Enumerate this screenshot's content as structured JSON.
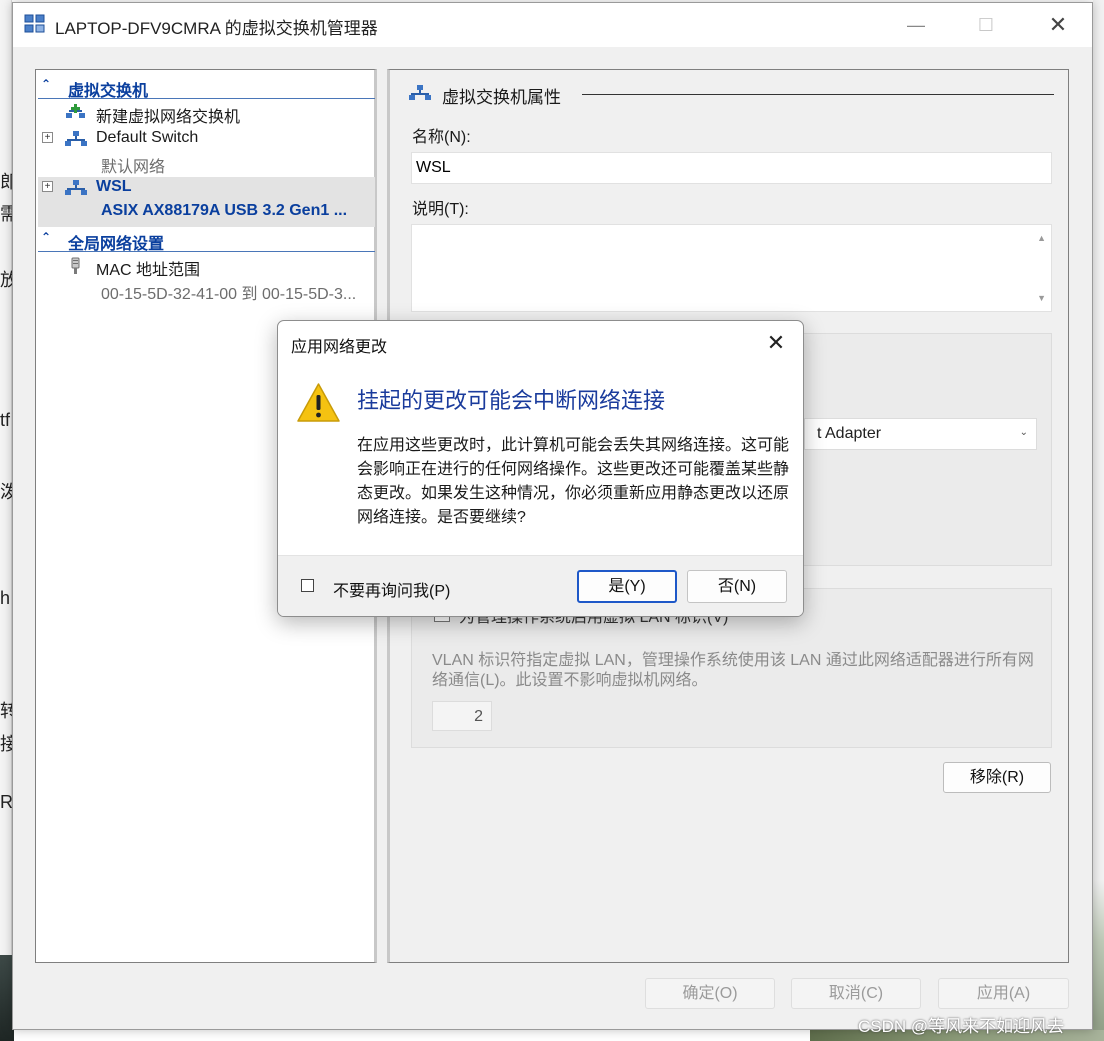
{
  "window": {
    "title": "LAPTOP-DFV9CMRA 的虚拟交换机管理器",
    "minimize_glyph": "—",
    "maximize_glyph": "☐",
    "close_glyph": "✕"
  },
  "tree": {
    "section_switches": "虚拟交换机",
    "new_switch": "新建虚拟网络交换机",
    "items": [
      {
        "name": "Default Switch",
        "subtitle": "默认网络",
        "expander": "+",
        "selected": false
      },
      {
        "name": "WSL",
        "subtitle": "ASIX AX88179A USB 3.2 Gen1 ...",
        "expander": "+",
        "selected": true
      }
    ],
    "section_global": "全局网络设置",
    "mac_range": {
      "name": "MAC 地址范围",
      "subtitle": "00-15-5D-32-41-00 到 00-15-5D-3..."
    },
    "collapse_glyph": "⌃"
  },
  "props": {
    "header": "虚拟交换机属性",
    "name_label": "名称(N):",
    "name_value": "WSL",
    "notes_label": "说明(T):",
    "notes_value": "",
    "adapter_value": "t Adapter",
    "vlan_checkbox_label": "为管理操作系统启用虚拟 LAN 标识(V)",
    "vlan_description": "VLAN 标识符指定虚拟 LAN，管理操作系统使用该 LAN 通过此网络适配器进行所有网络通信(L)。此设置不影响虚拟机网络。",
    "vlan_id": "2",
    "remove_button": "移除(R)"
  },
  "footer": {
    "ok": "确定(O)",
    "cancel": "取消(C)",
    "apply": "应用(A)"
  },
  "dialog": {
    "title": "应用网络更改",
    "close_glyph": "✕",
    "heading": "挂起的更改可能会中断网络连接",
    "body": "在应用这些更改时，此计算机可能会丢失其网络连接。这可能会影响正在进行的任何网络操作。这些更改还可能覆盖某些静态更改。如果发生这种情况，你必须重新应用静态更改以还原网络连接。是否要继续?",
    "dont_ask_label": "不要再询问我(P)",
    "dont_ask_checked": false,
    "yes": "是(Y)",
    "no": "否(N)"
  },
  "background": {
    "left_fragments": [
      "郎",
      "需",
      "放",
      "tf",
      "泼",
      "h",
      "转",
      "接",
      "R"
    ],
    "watermark": "CSDN @等风来不如迎风去"
  },
  "colors": {
    "accent_blue": "#0a3f9e",
    "dialog_heading": "#1a3b9c",
    "default_button_border": "#1e58c8",
    "warning_yellow": "#f5c211"
  },
  "icons": {
    "app": "virtual-switch-manager-icon",
    "switch": "network-switch-icon",
    "new_switch": "add-network-switch-icon",
    "mac": "plug-icon",
    "warning": "warning-icon"
  }
}
